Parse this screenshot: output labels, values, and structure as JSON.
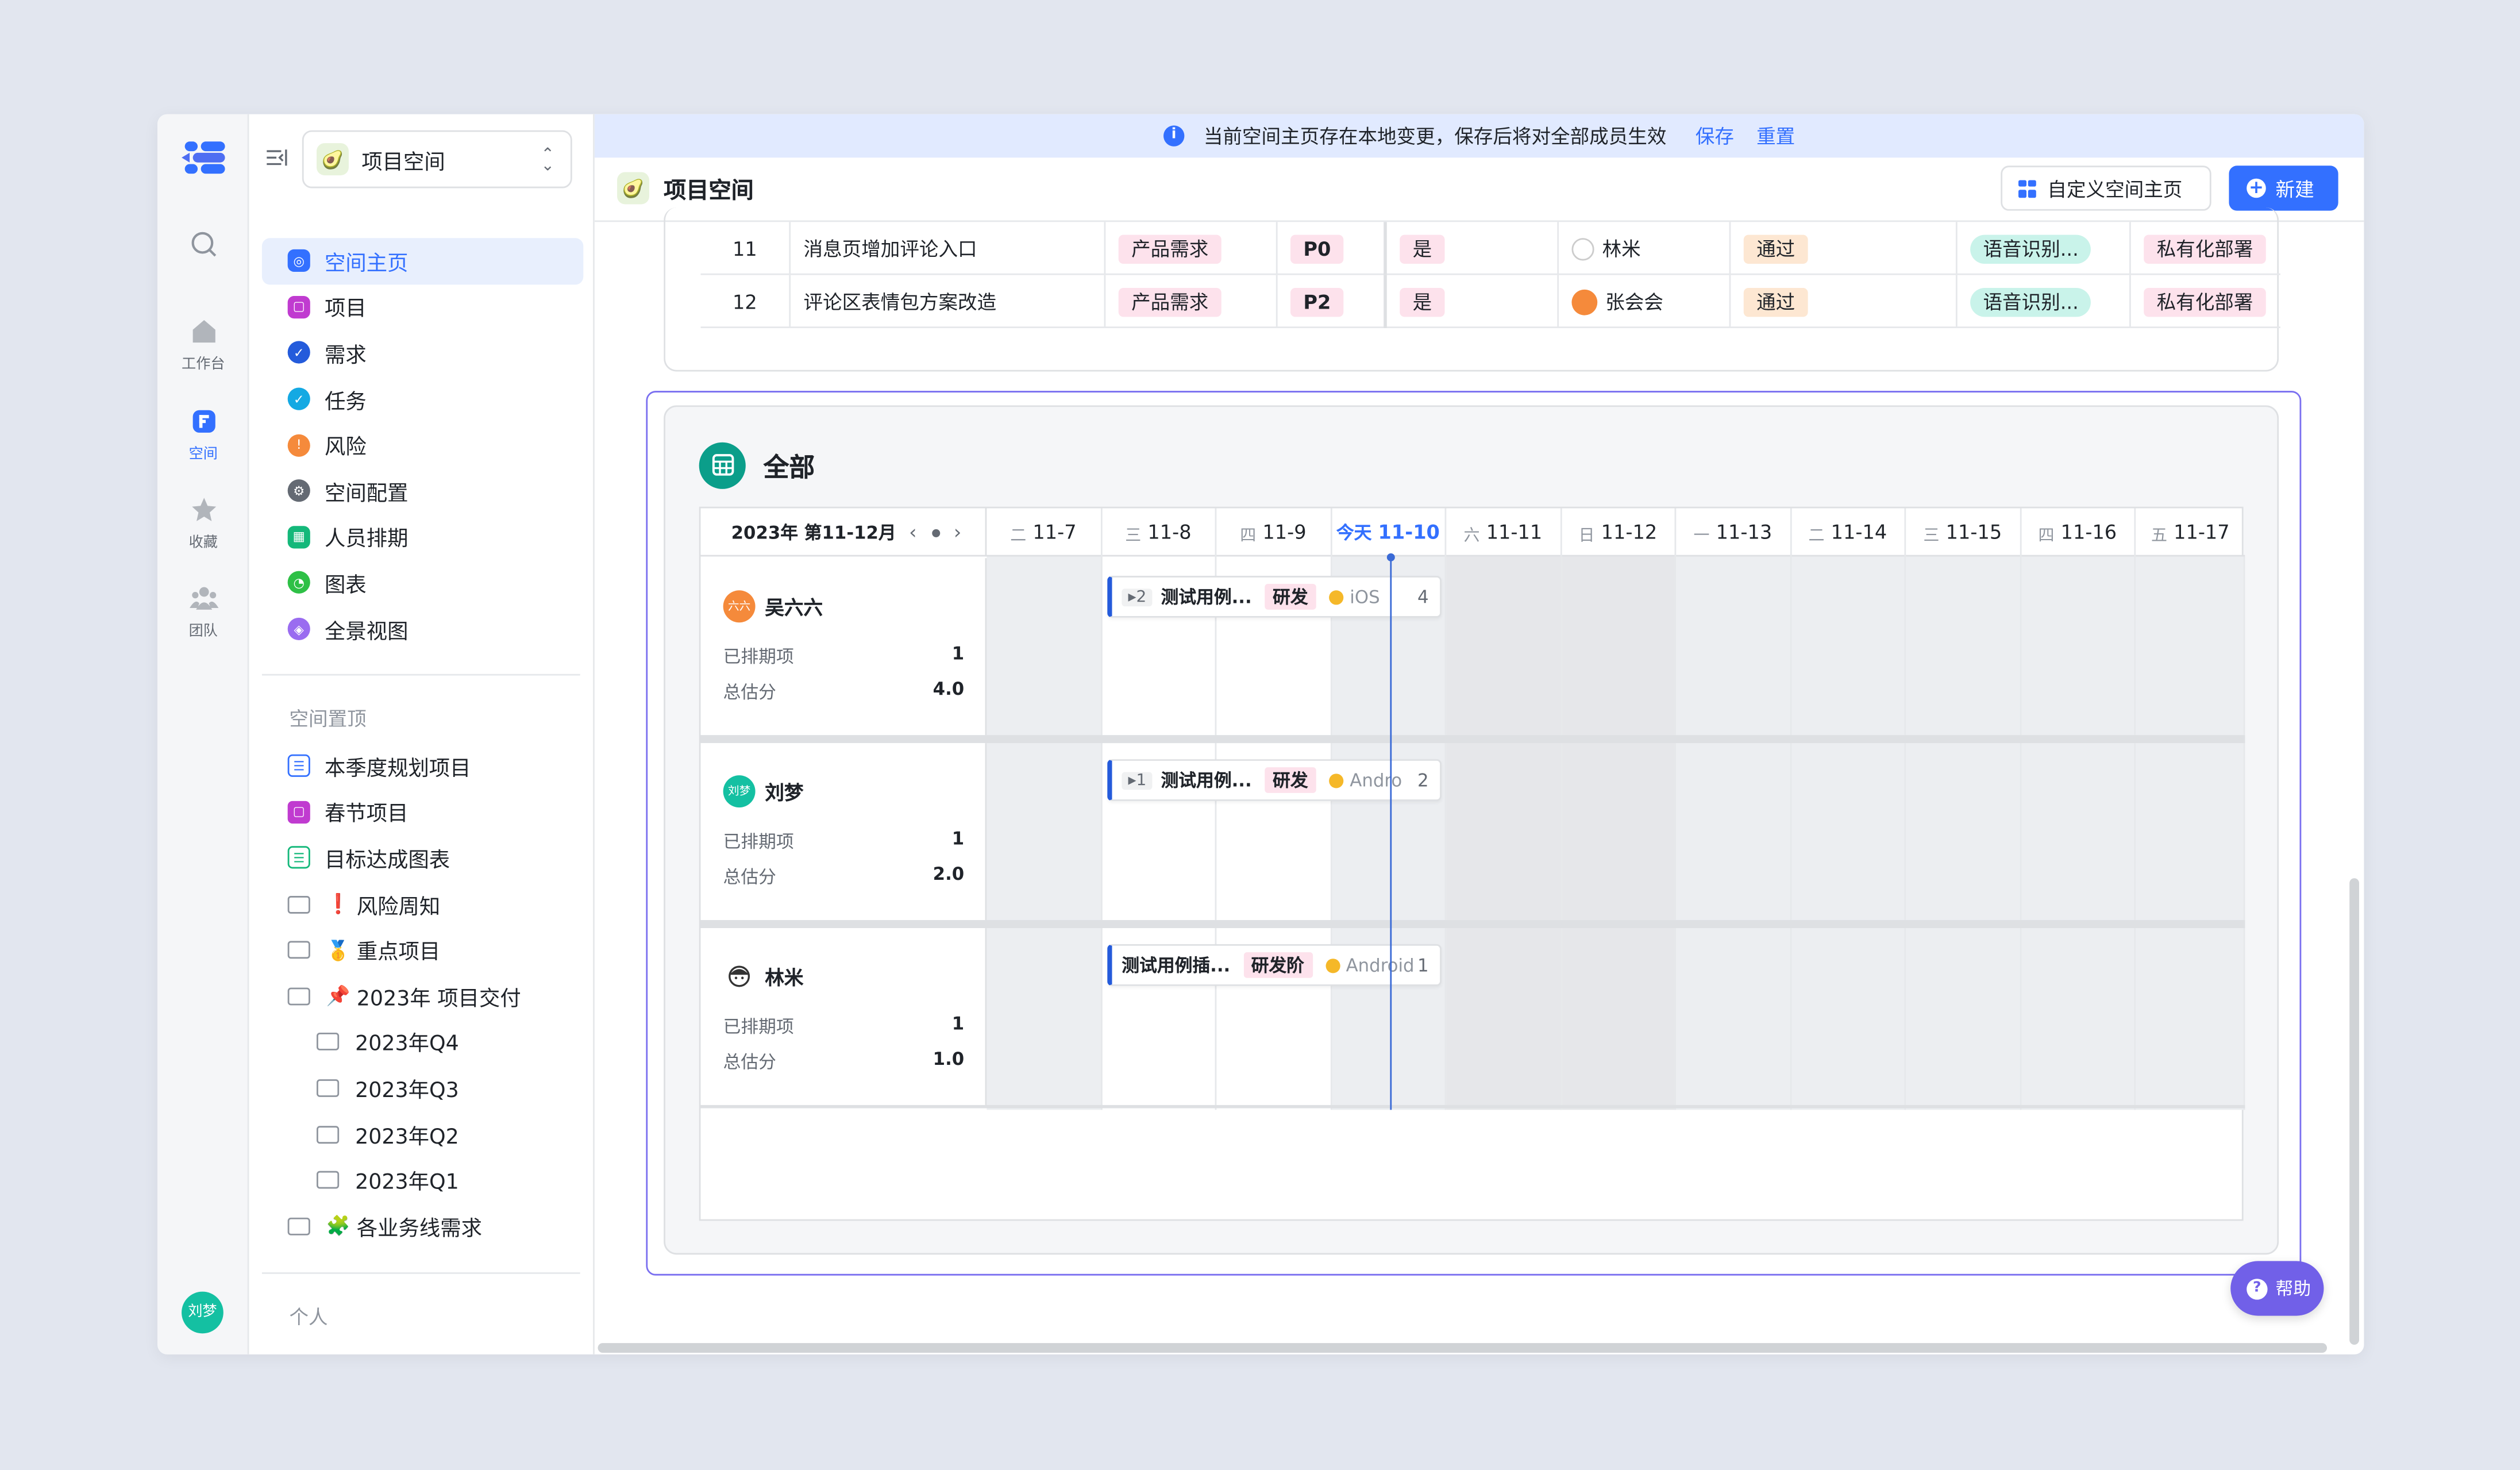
{
  "colors": {
    "accent": "#3370ff",
    "selection": "#7a6ff0",
    "help": "#7160e8"
  },
  "rail": {
    "items": [
      {
        "label": "",
        "icon": "search-icon"
      },
      {
        "label": "工作台",
        "icon": "home-icon"
      },
      {
        "label": "空间",
        "icon": "space-icon"
      },
      {
        "label": "收藏",
        "icon": "star-icon"
      },
      {
        "label": "团队",
        "icon": "team-icon"
      }
    ],
    "avatar": "刘梦"
  },
  "sidebar": {
    "space_name": "项目空间",
    "nav": [
      {
        "label": "空间主页",
        "color": "#3370ff"
      },
      {
        "label": "项目",
        "color": "#c03bd0"
      },
      {
        "label": "需求",
        "color": "#245bdb"
      },
      {
        "label": "任务",
        "color": "#14a9e3"
      },
      {
        "label": "风险",
        "color": "#f58a3b"
      },
      {
        "label": "空间配置",
        "color": "#646a73"
      },
      {
        "label": "人员排期",
        "color": "#14b87a"
      },
      {
        "label": "图表",
        "color": "#2ec046"
      },
      {
        "label": "全景视图",
        "color": "#9a6cf0"
      }
    ],
    "pinned_title": "空间置顶",
    "pinned": [
      {
        "label": "本季度规划项目",
        "type": "doc-blue"
      },
      {
        "label": "春节项目",
        "type": "doc-purple"
      },
      {
        "label": "目标达成图表",
        "type": "doc-green"
      },
      {
        "label": "风险周知",
        "type": "folder",
        "emoji": "❗"
      },
      {
        "label": "重点项目",
        "type": "folder",
        "emoji": "🥇"
      },
      {
        "label": "2023年 项目交付",
        "type": "folder",
        "emoji": "📌"
      },
      {
        "label": "2023年Q4",
        "type": "subfolder"
      },
      {
        "label": "2023年Q3",
        "type": "subfolder"
      },
      {
        "label": "2023年Q2",
        "type": "subfolder"
      },
      {
        "label": "2023年Q1",
        "type": "subfolder"
      },
      {
        "label": "各业务线需求",
        "type": "folder",
        "emoji": "🧩"
      }
    ],
    "personal_title": "个人"
  },
  "banner": {
    "text": "当前空间主页存在本地变更，保存后将对全部成员生效",
    "save": "保存",
    "reset": "重置"
  },
  "header": {
    "title": "项目空间",
    "customize": "自定义空间主页",
    "new": "新建"
  },
  "table": {
    "rows": [
      {
        "no": "11",
        "title": "消息页增加评论入口",
        "type": "产品需求",
        "priority": "P0",
        "flag": "是",
        "owner": "林米",
        "status": "通过",
        "tag": "语音识别...",
        "extra": "私有化部署"
      },
      {
        "no": "12",
        "title": "评论区表情包方案改造",
        "type": "产品需求",
        "priority": "P2",
        "flag": "是",
        "owner": "张会会",
        "status": "通过",
        "tag": "语音识别...",
        "extra": "私有化部署"
      }
    ]
  },
  "gantt": {
    "title": "全部",
    "range": "2023年 第11-12月",
    "days": [
      {
        "wd": "二",
        "date": "11-7"
      },
      {
        "wd": "三",
        "date": "11-8"
      },
      {
        "wd": "四",
        "date": "11-9"
      },
      {
        "wd": "今天",
        "date": "11-10",
        "today": true
      },
      {
        "wd": "六",
        "date": "11-11"
      },
      {
        "wd": "日",
        "date": "11-12"
      },
      {
        "wd": "一",
        "date": "11-13"
      },
      {
        "wd": "二",
        "date": "11-14"
      },
      {
        "wd": "三",
        "date": "11-15"
      },
      {
        "wd": "四",
        "date": "11-16"
      },
      {
        "wd": "五",
        "date": "11-17"
      }
    ],
    "lanes": [
      {
        "name": "吴六六",
        "avatar": "六六",
        "avatar_color": "#f58a3b",
        "scheduled_label": "已排期项",
        "scheduled": "1",
        "estimate_label": "总估分",
        "estimate": "4.0",
        "task": {
          "count": "▸2",
          "title": "测试用例...",
          "stage": "研发",
          "platform": "iOS",
          "num": "4"
        }
      },
      {
        "name": "刘梦",
        "avatar": "刘梦",
        "avatar_color": "#14c0a2",
        "scheduled_label": "已排期项",
        "scheduled": "1",
        "estimate_label": "总估分",
        "estimate": "2.0",
        "task": {
          "count": "▸1",
          "title": "测试用例...",
          "stage": "研发",
          "platform": "Andro",
          "num": "2"
        }
      },
      {
        "name": "林米",
        "avatar": "",
        "avatar_color": "#ffffff",
        "scheduled_label": "已排期项",
        "scheduled": "1",
        "estimate_label": "总估分",
        "estimate": "1.0",
        "task": {
          "count": "",
          "title": "测试用例插...",
          "stage": "研发阶",
          "platform": "Android",
          "num": "1"
        }
      }
    ]
  },
  "help": "帮助"
}
